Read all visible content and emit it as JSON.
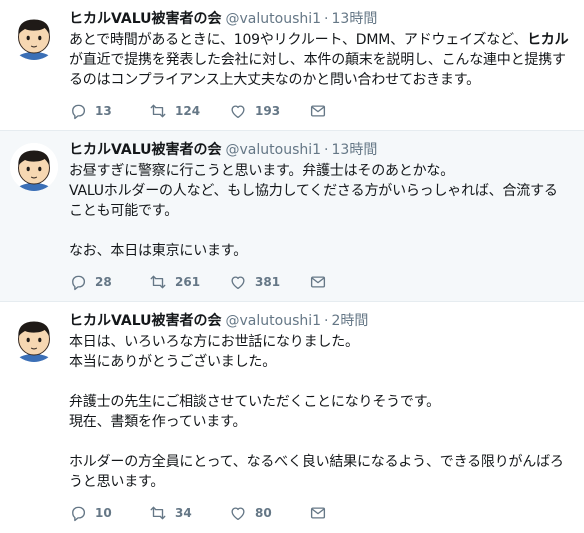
{
  "colors": {
    "text": "#14171a",
    "muted": "#657786",
    "highlight_bg": "#f5f8fa",
    "divider": "#e6ecf0"
  },
  "icons": {
    "reply": "reply-icon",
    "retweet": "retweet-icon",
    "like": "like-icon",
    "dm": "direct-message-icon",
    "avatar": "avatar-illustration"
  },
  "tweets": [
    {
      "name": "ヒカルVALU被害者の会",
      "handle": "@valutoushi1",
      "sep": "·",
      "time": "13時間",
      "highlighted": false,
      "lines": [
        [
          "あとで時間があるときに、109やリクルート、DMM、アドウェイズなど、",
          "ヒカル",
          ""
        ],
        [
          "が直近で提携を発表した会社に対し、本件の顛末を説明し、こんな連中と提携す",
          "",
          ""
        ],
        [
          "るのはコンプライアンス上大丈夫なのかと問い合わせておきます。",
          "",
          ""
        ]
      ],
      "replies": "13",
      "retweets": "124",
      "likes": "193"
    },
    {
      "name": "ヒカルVALU被害者の会",
      "handle": "@valutoushi1",
      "sep": "·",
      "time": "13時間",
      "highlighted": true,
      "lines": [
        [
          "お昼すぎに警察に行こうと思います。弁護士はそのあとかな。",
          "",
          ""
        ],
        [
          "VALUホルダーの人など、もし協力してくださる方がいらっしゃれば、合流する",
          "",
          ""
        ],
        [
          "ことも可能です。",
          "",
          ""
        ],
        [
          "",
          "",
          ""
        ],
        [
          "なお、本日は東京にいます。",
          "",
          ""
        ]
      ],
      "replies": "28",
      "retweets": "261",
      "likes": "381"
    },
    {
      "name": "ヒカルVALU被害者の会",
      "handle": "@valutoushi1",
      "sep": "·",
      "time": "2時間",
      "highlighted": false,
      "lines": [
        [
          "本日は、いろいろな方にお世話になりました。",
          "",
          ""
        ],
        [
          "本当にありがとうございました。",
          "",
          ""
        ],
        [
          "",
          "",
          ""
        ],
        [
          "弁護士の先生にご相談させていただくことになりそうです。",
          "",
          ""
        ],
        [
          "現在、書類を作っています。",
          "",
          ""
        ],
        [
          "",
          "",
          ""
        ],
        [
          "ホルダーの方全員にとって、なるべく良い結果になるよう、できる限りがんばろ",
          "",
          ""
        ],
        [
          "うと思います。",
          "",
          ""
        ]
      ],
      "replies": "10",
      "retweets": "34",
      "likes": "80"
    }
  ]
}
